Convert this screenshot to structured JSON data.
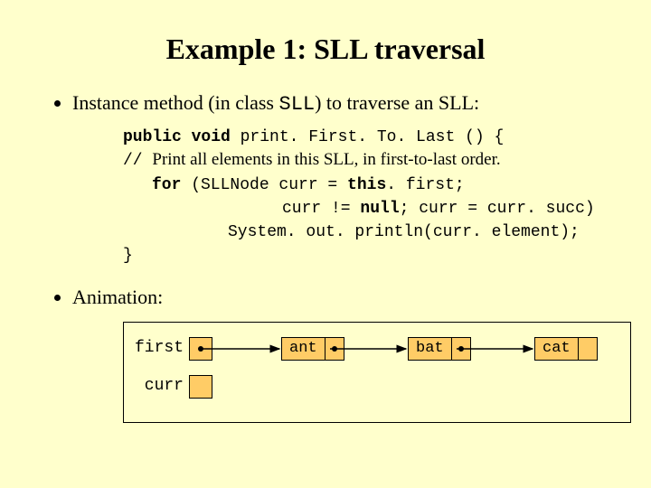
{
  "title": "Example 1: SLL traversal",
  "bullet1_pre": "Instance method (in class ",
  "bullet1_code": "SLL",
  "bullet1_post": ") to traverse an SLL:",
  "code": {
    "l1a": "public void",
    "l1b": " print. First. To. Last () {",
    "l2a": "// ",
    "l2b": "Print all elements in this SLL, in first-to-last order.",
    "l3a": "for",
    "l3b": " (SLLNode curr = ",
    "l3c": "this",
    "l3d": ". first;",
    "l4a": "curr != ",
    "l4b": "null",
    "l4c": "; curr = curr. succ)",
    "l5": "System. out. println(curr. element);",
    "l6": "}"
  },
  "bullet2": "Animation:",
  "diagram": {
    "first_label": "first",
    "curr_label": "curr",
    "nodes": [
      "ant",
      "bat",
      "cat"
    ]
  }
}
